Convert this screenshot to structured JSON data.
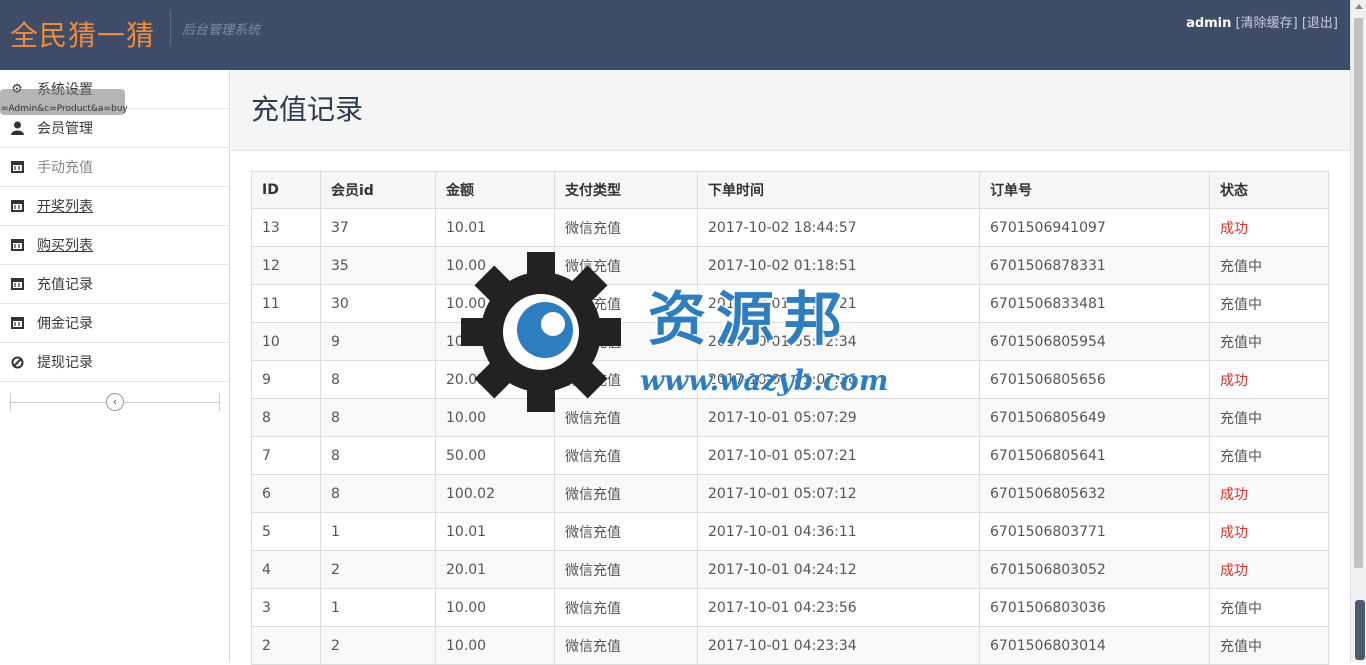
{
  "brand": {
    "title": "全民猜一猜",
    "subtitle": "后台管理系统"
  },
  "topbar": {
    "user": "admin",
    "clear_cache": "[清除缓存]",
    "logout": "[退出]"
  },
  "sidebar": {
    "items": [
      {
        "label": "系统设置",
        "icon": "gear-icon"
      },
      {
        "label": "会员管理",
        "icon": "user-icon"
      },
      {
        "label": "手动充值",
        "icon": "calendar-icon"
      },
      {
        "label": "开奖列表",
        "icon": "calendar-icon"
      },
      {
        "label": "购买列表",
        "icon": "calendar-icon"
      },
      {
        "label": "充值记录",
        "icon": "calendar-icon"
      },
      {
        "label": "佣金记录",
        "icon": "calendar-icon"
      },
      {
        "label": "提现记录",
        "icon": "ban-icon"
      }
    ],
    "tooltip": "=Admin&c=Product&a=buy"
  },
  "page": {
    "title": "充值记录"
  },
  "table": {
    "headers": [
      "ID",
      "会员id",
      "金额",
      "支付类型",
      "下单时间",
      "订单号",
      "状态"
    ],
    "rows": [
      [
        "13",
        "37",
        "10.01",
        "微信充值",
        "2017-10-02 18:44:57",
        "6701506941097",
        "成功"
      ],
      [
        "12",
        "35",
        "10.00",
        "微信充值",
        "2017-10-02 01:18:51",
        "6701506878331",
        "充值中"
      ],
      [
        "11",
        "30",
        "10.00",
        "微信充值",
        "2017-10-01 12:51:21",
        "6701506833481",
        "充值中"
      ],
      [
        "10",
        "9",
        "10.02",
        "微信充值",
        "2017-10-01 05:12:34",
        "6701506805954",
        "充值中"
      ],
      [
        "9",
        "8",
        "20.01",
        "微信充值",
        "2017-10-01 05:07:36",
        "6701506805656",
        "成功"
      ],
      [
        "8",
        "8",
        "10.00",
        "微信充值",
        "2017-10-01 05:07:29",
        "6701506805649",
        "充值中"
      ],
      [
        "7",
        "8",
        "50.00",
        "微信充值",
        "2017-10-01 05:07:21",
        "6701506805641",
        "充值中"
      ],
      [
        "6",
        "8",
        "100.02",
        "微信充值",
        "2017-10-01 05:07:12",
        "6701506805632",
        "成功"
      ],
      [
        "5",
        "1",
        "10.01",
        "微信充值",
        "2017-10-01 04:36:11",
        "6701506803771",
        "成功"
      ],
      [
        "4",
        "2",
        "20.01",
        "微信充值",
        "2017-10-01 04:24:12",
        "6701506803052",
        "成功"
      ],
      [
        "3",
        "1",
        "10.00",
        "微信充值",
        "2017-10-01 04:23:56",
        "6701506803036",
        "充值中"
      ],
      [
        "2",
        "2",
        "10.00",
        "微信充值",
        "2017-10-01 04:23:34",
        "6701506803014",
        "充值中"
      ]
    ]
  },
  "watermark": {
    "text": "资源邦",
    "url": "www.wazyb.com"
  },
  "colors": {
    "navbar": "#3e4c68",
    "brand": "#f08a3c",
    "success": "#d9342b",
    "watermark": "#2e7dbf"
  }
}
